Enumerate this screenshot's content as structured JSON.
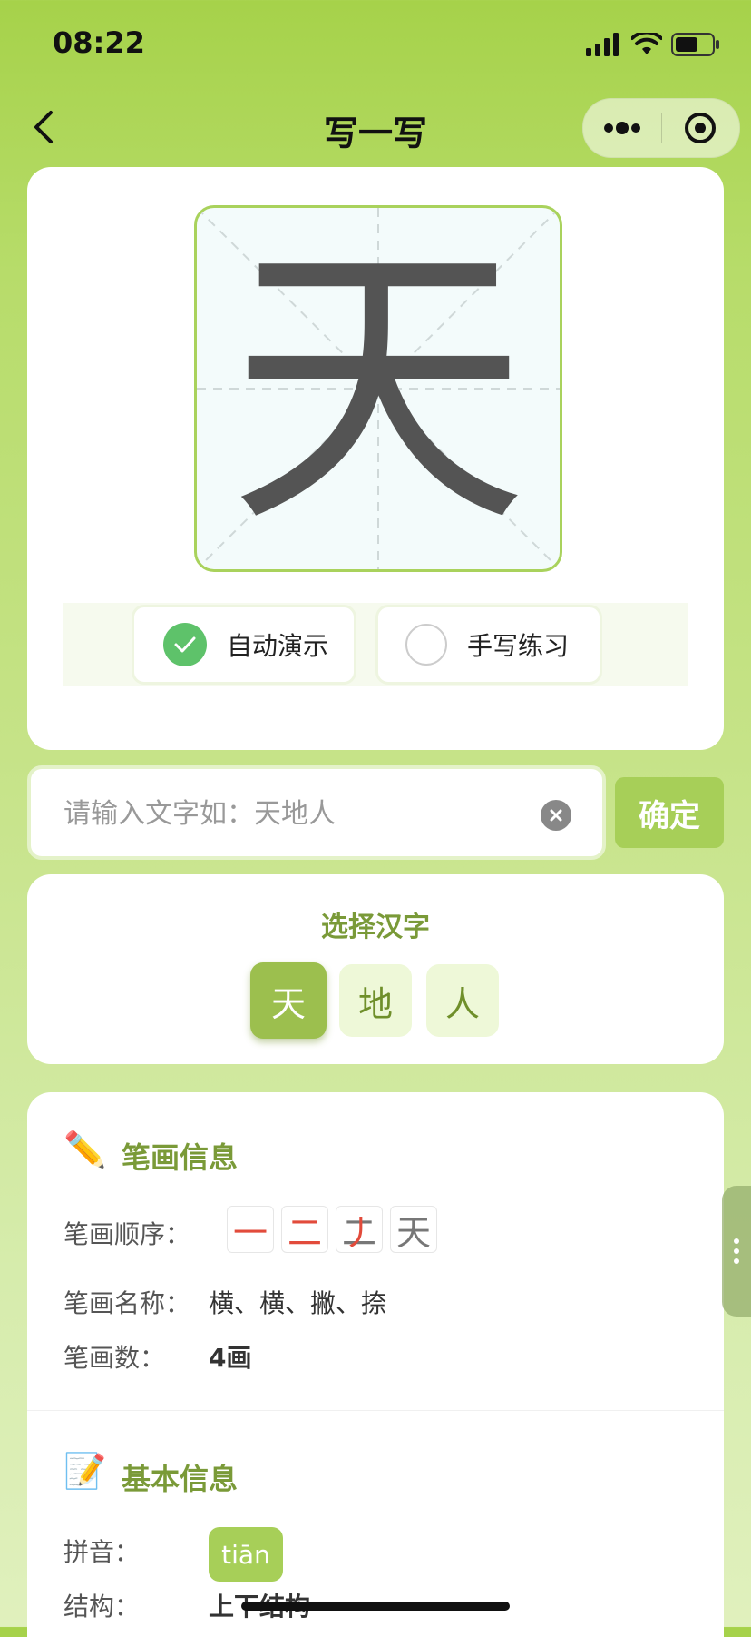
{
  "status_bar": {
    "time": "08:22"
  },
  "nav": {
    "title": "写一写",
    "back_icon": "chevron-left-icon",
    "more_icon": "more-icon",
    "close_icon": "target-circle-icon"
  },
  "demo": {
    "character": "天"
  },
  "modes": [
    {
      "label": "自动演示",
      "selected": true
    },
    {
      "label": "手写练习",
      "selected": false
    }
  ],
  "search": {
    "placeholder": "请输入文字如：天地人",
    "value": "",
    "confirm_label": "确定"
  },
  "select": {
    "title": "选择汉字",
    "chars": [
      {
        "char": "天",
        "active": true
      },
      {
        "char": "地",
        "active": false
      },
      {
        "char": "人",
        "active": false
      }
    ]
  },
  "stroke_info": {
    "title": "笔画信息",
    "icon": "✏️",
    "order_label": "笔画顺序：",
    "order_frames": [
      {
        "before": "",
        "highlight": "一"
      },
      {
        "before": "",
        "highlight": "二"
      },
      {
        "before": "二",
        "highlight": "丿"
      },
      {
        "before": "天",
        "highlight": ""
      }
    ],
    "name_label": "笔画名称：",
    "name_value": "横、横、撇、捺",
    "count_label": "笔画数：",
    "count_value": "4画"
  },
  "basic_info": {
    "title": "基本信息",
    "icon": "📝",
    "pinyin_label": "拼音：",
    "pinyin_value": "tiān",
    "structure_label": "结构：",
    "structure_value": "上下结构"
  },
  "colors": {
    "accent": "#a7cf58",
    "title_green": "#7a9a38",
    "check_green": "#5ec26a",
    "stroke_red": "#e24b3b"
  }
}
